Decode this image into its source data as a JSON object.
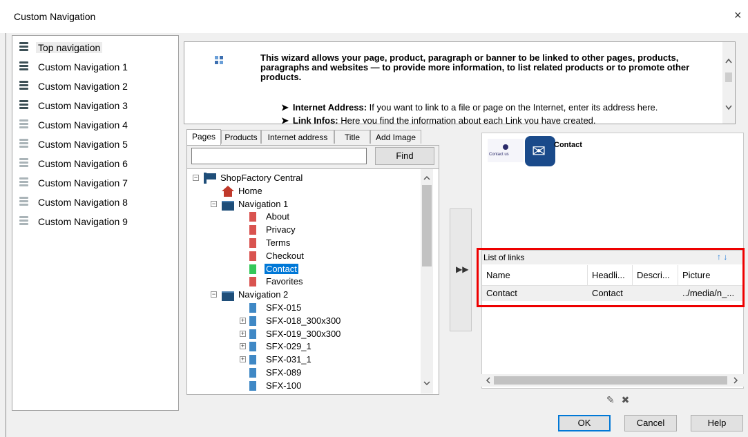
{
  "window": {
    "title": "Custom Navigation",
    "close": "×"
  },
  "nav": {
    "items": [
      {
        "label": "Top navigation",
        "active": true
      },
      {
        "label": "Custom Navigation 1",
        "active": true
      },
      {
        "label": "Custom Navigation 2",
        "active": true
      },
      {
        "label": "Custom Navigation 3",
        "active": true
      },
      {
        "label": "Custom Navigation 4",
        "active": false
      },
      {
        "label": "Custom Navigation 5",
        "active": false
      },
      {
        "label": "Custom Navigation 6",
        "active": false
      },
      {
        "label": "Custom Navigation 7",
        "active": false
      },
      {
        "label": "Custom Navigation 8",
        "active": false
      },
      {
        "label": "Custom Navigation 9",
        "active": false
      }
    ]
  },
  "help": {
    "intro": "This wizard allows your page, product, paragraph or banner to be linked to other pages, products, paragraphs and websites — to provide more information, to list related products or to promote other products.",
    "bullet1_title": "Internet Address:",
    "bullet1_text": " If you want to link to a file or page on the Internet, enter its address here.",
    "bullet2_title": "Link Infos:",
    "bullet2_text": " Here you find the information about each Link you have created."
  },
  "tabs": [
    "Pages",
    "Products",
    "Internet address",
    "Title",
    "Add Image"
  ],
  "search": {
    "value": "",
    "find_label": "Find"
  },
  "tree": [
    {
      "label": "ShopFactory Central",
      "icon": "flag",
      "expander": "−"
    },
    {
      "label": "Home",
      "icon": "home"
    },
    {
      "label": "Navigation 1",
      "icon": "folder",
      "expander": "−"
    },
    {
      "label": "About",
      "icon": "page-red"
    },
    {
      "label": "Privacy",
      "icon": "page-red"
    },
    {
      "label": "Terms",
      "icon": "page-red"
    },
    {
      "label": "Checkout",
      "icon": "page-red"
    },
    {
      "label": "Contact",
      "icon": "page-green",
      "selected": true
    },
    {
      "label": "Favorites",
      "icon": "page-red"
    },
    {
      "label": "Navigation 2",
      "icon": "folder",
      "expander": "−"
    },
    {
      "label": "SFX-015",
      "icon": "page-blue"
    },
    {
      "label": "SFX-018_300x300",
      "icon": "page-blue",
      "expander": "+"
    },
    {
      "label": "SFX-019_300x300",
      "icon": "page-blue",
      "expander": "+"
    },
    {
      "label": "SFX-029_1",
      "icon": "page-blue",
      "expander": "+"
    },
    {
      "label": "SFX-031_1",
      "icon": "page-blue",
      "expander": "+"
    },
    {
      "label": "SFX-089",
      "icon": "page-blue"
    },
    {
      "label": "SFX-100",
      "icon": "page-blue"
    }
  ],
  "add_button": {
    "icon": "double-chevron-right-icon",
    "glyph": "▶▶"
  },
  "preview": {
    "title": "Contact",
    "thumb_text": "Contact us"
  },
  "links": {
    "header": "List of links",
    "arrows": "↑ ↓",
    "columns": [
      "Name",
      "Headli...",
      "Descri...",
      "Picture"
    ],
    "rows": [
      [
        "Contact",
        "Contact",
        "",
        "../media/n_..."
      ]
    ]
  },
  "tools": {
    "edit": "✎",
    "delete": "✖"
  },
  "buttons": {
    "ok": "OK",
    "cancel": "Cancel",
    "help": "Help"
  },
  "colors": {
    "selection": "#0078d7",
    "highlight_box": "#e00000",
    "accent_arrows": "#1e7ad8"
  }
}
